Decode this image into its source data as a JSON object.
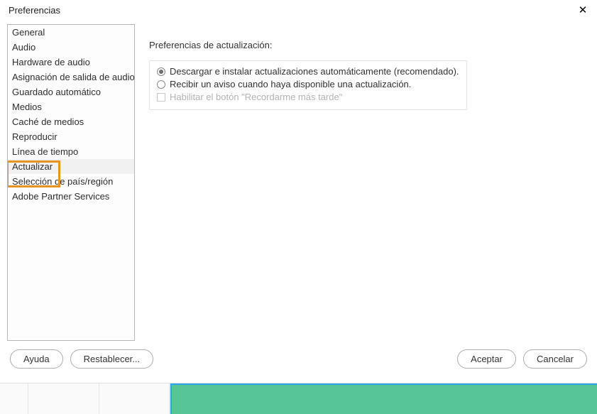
{
  "titlebar": {
    "title": "Preferencias"
  },
  "sidebar": {
    "items": [
      {
        "label": "General"
      },
      {
        "label": "Audio"
      },
      {
        "label": "Hardware de audio"
      },
      {
        "label": "Asignación de salida de audio"
      },
      {
        "label": "Guardado automático"
      },
      {
        "label": "Medios"
      },
      {
        "label": "Caché de medios"
      },
      {
        "label": "Reproducir"
      },
      {
        "label": "Línea de tiempo"
      },
      {
        "label": "Actualizar"
      },
      {
        "label": "Selección de país/región"
      },
      {
        "label": "Adobe Partner Services"
      }
    ]
  },
  "content": {
    "section_title": "Preferencias de actualización:",
    "option_auto": "Descargar e instalar actualizaciones automáticamente (recomendado).",
    "option_notify": "Recibir un aviso cuando haya disponible una actualización.",
    "option_remind": "Habilitar el botón \"Recordarme más tarde\""
  },
  "buttons": {
    "help": "Ayuda",
    "reset": "Restablecer...",
    "ok": "Aceptar",
    "cancel": "Cancelar"
  }
}
